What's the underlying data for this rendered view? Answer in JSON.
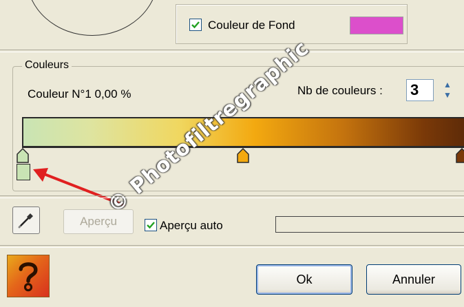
{
  "top": {
    "fond_checkbox_label": "Couleur de Fond",
    "fond_checked": true,
    "fond_color": "#dc4fcb"
  },
  "couleurs": {
    "group_label": "Couleurs",
    "current_color_label": "Couleur N°1 0,00 %",
    "count_label": "Nb de couleurs :",
    "count_value": "3",
    "gradient_colors": [
      "#c9e4b4",
      "#f3a910",
      "#5c2a08"
    ]
  },
  "watermark": "© Photofiltregraphic",
  "toolbar": {
    "apercu_label": "Aperçu",
    "apercu_auto_label": "Aperçu auto",
    "apercu_auto_checked": true
  },
  "footer": {
    "ok_label": "Ok",
    "cancel_label": "Annuler"
  },
  "colors": {
    "annotation_arrow": "#e02020"
  }
}
